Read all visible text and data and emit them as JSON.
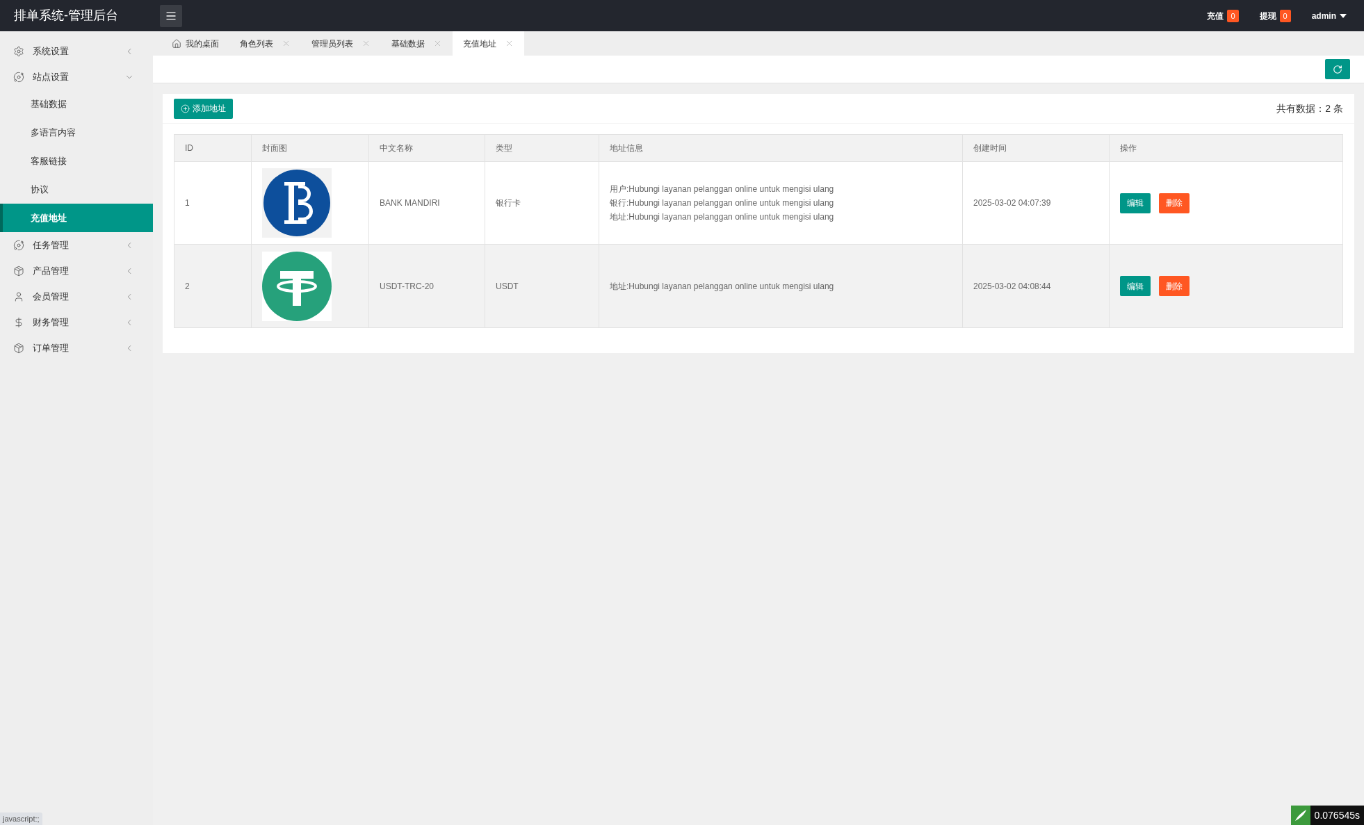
{
  "header": {
    "title": "排单系统-管理后台",
    "links": [
      {
        "label": "充值",
        "badge": "0"
      },
      {
        "label": "提现",
        "badge": "0"
      }
    ],
    "user": "admin"
  },
  "sidebar": {
    "items": [
      {
        "label": "系统设置",
        "expanded": false
      },
      {
        "label": "站点设置",
        "expanded": true,
        "children": [
          {
            "label": "基础数据",
            "selected": false
          },
          {
            "label": "多语言内容",
            "selected": false
          },
          {
            "label": "客服链接",
            "selected": false
          },
          {
            "label": "协议",
            "selected": false
          },
          {
            "label": "充值地址",
            "selected": true
          }
        ]
      },
      {
        "label": "任务管理",
        "expanded": false
      },
      {
        "label": "产品管理",
        "expanded": false
      },
      {
        "label": "会员管理",
        "expanded": false
      },
      {
        "label": "财务管理",
        "expanded": false
      },
      {
        "label": "订单管理",
        "expanded": false
      }
    ]
  },
  "tabs": [
    {
      "label": "我的桌面",
      "kind": "home",
      "selected": false
    },
    {
      "label": "角色列表",
      "kind": "closable",
      "selected": false
    },
    {
      "label": "管理员列表",
      "kind": "closable",
      "selected": false
    },
    {
      "label": "基础数据",
      "kind": "closable",
      "selected": false
    },
    {
      "label": "充值地址",
      "kind": "closable",
      "selected": true
    }
  ],
  "panel": {
    "add_button": "添加地址",
    "total": "共有数据：2 条"
  },
  "table": {
    "columns": [
      "ID",
      "封面图",
      "中文名称",
      "类型",
      "地址信息",
      "创建时间",
      "操作"
    ],
    "rows": [
      {
        "id": "1",
        "name": "BANK MANDIRI",
        "type": "银行卡",
        "address_info": [
          "用户:Hubungi layanan pelanggan online untuk mengisi ulang",
          "银行:Hubungi layanan pelanggan online untuk mengisi ulang",
          "地址:Hubungi layanan pelanggan online untuk mengisi ulang"
        ],
        "created": "2025-03-02 04:07:39",
        "actions": [
          "编辑",
          "删除"
        ]
      },
      {
        "id": "2",
        "name": "USDT-TRC-20",
        "type": "USDT",
        "address_info": [
          "地址:Hubungi layanan pelanggan online untuk mengisi ulang"
        ],
        "created": "2025-03-02 04:08:44",
        "actions": [
          "编辑",
          "删除"
        ]
      }
    ]
  },
  "status_text": "javascript:;",
  "debug_time": "0.076545s"
}
